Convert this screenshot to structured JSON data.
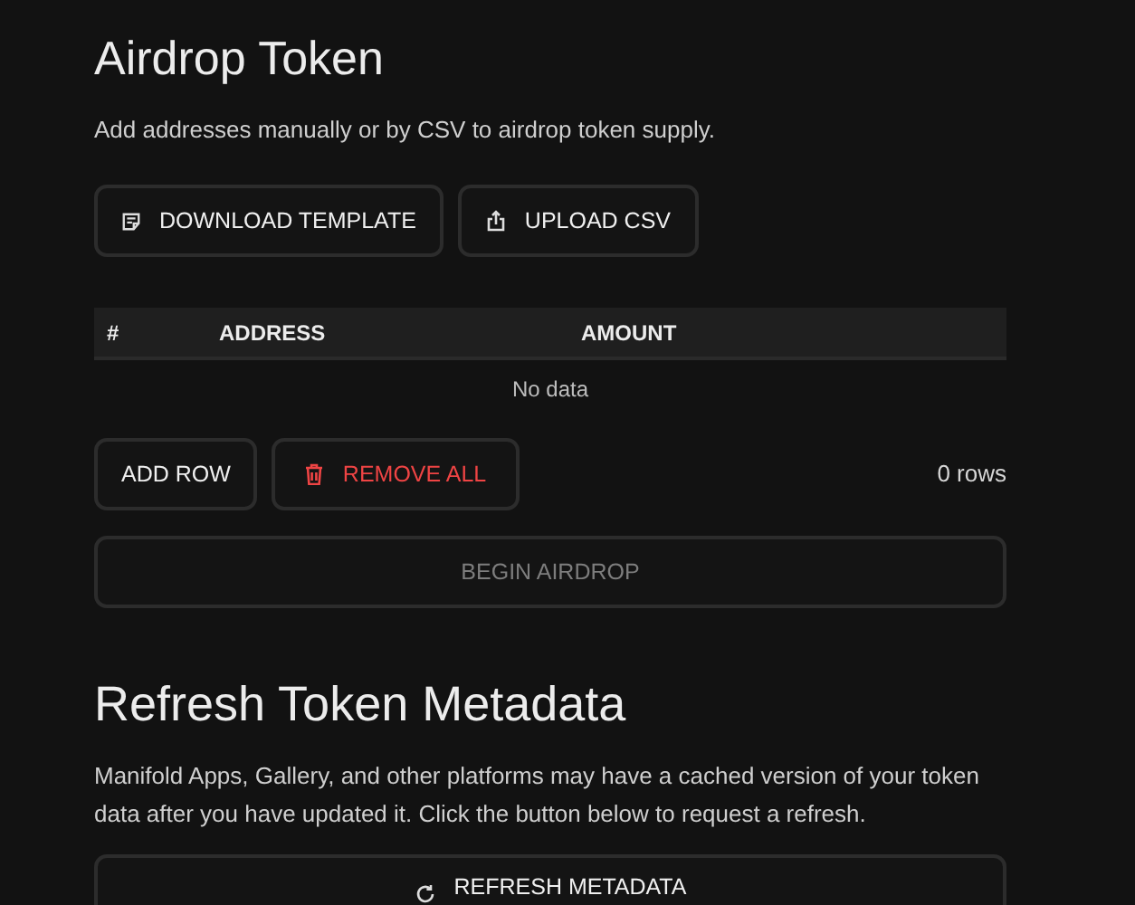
{
  "airdrop": {
    "title": "Airdrop Token",
    "description": "Add addresses manually or by CSV to airdrop token supply.",
    "file_buttons": [
      {
        "label": "DOWNLOAD TEMPLATE",
        "kind": "template"
      },
      {
        "label": "UPLOAD CSV",
        "kind": "upload"
      }
    ],
    "table": {
      "columns": [
        "#",
        "ADDRESS",
        "AMOUNT"
      ],
      "empty_text": "No data"
    },
    "row_buttons": [
      {
        "label": "ADD ROW",
        "kind": "plain"
      },
      {
        "label": "REMOVE ALL",
        "kind": "danger"
      }
    ],
    "row_count": "0 rows",
    "submit": {
      "label": "BEGIN AIRDROP",
      "disabled": true
    }
  },
  "refresh": {
    "title": "Refresh Token Metadata",
    "description": "Manifold Apps, Gallery, and other platforms may have a cached version of your token data after you have updated it. Click the button below to request a refresh.",
    "button": {
      "label": "REFRESH METADATA"
    }
  }
}
